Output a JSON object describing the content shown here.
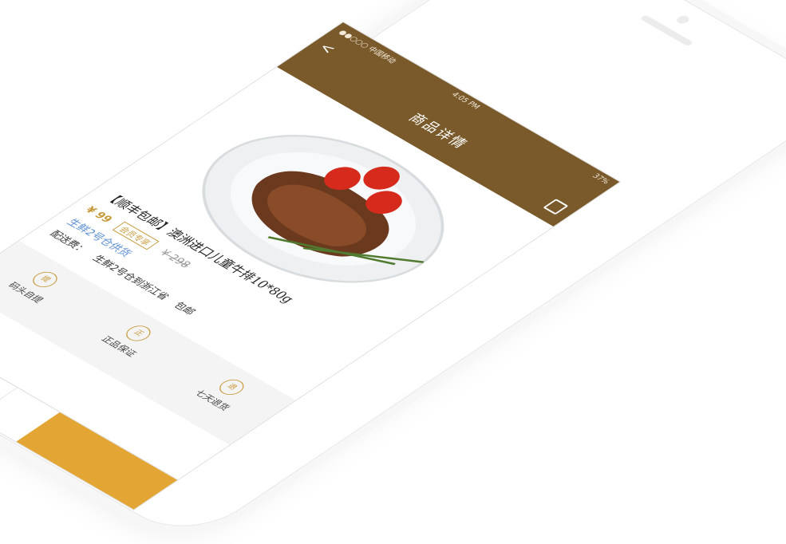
{
  "status": {
    "carrier": "●●○○○ 中国移动",
    "time": "4:05 PM",
    "battery": "37%"
  },
  "header": {
    "title": "商品详情",
    "back_icon": "chevron-left-icon",
    "share_icon": "share-icon"
  },
  "product": {
    "name": "【顺丰包邮】澳洲进口儿童牛排10*80g",
    "price": "¥ 99",
    "tag": "会员专享",
    "old_price": "¥ 298",
    "warehouse": "生鲜2号仓供货",
    "shipping_label": "配送费：",
    "shipping_route": "生鲜2号仓到浙江省",
    "shipping_fee": "包邮"
  },
  "guarantees": [
    {
      "badge": "提",
      "label": "码头自提"
    },
    {
      "badge": "正",
      "label": "正品保证"
    },
    {
      "badge": "退",
      "label": "七天退货"
    }
  ],
  "bottom_bar": {
    "home_icon": "home-icon",
    "chat_icon": "chat-icon",
    "star_icon": "star-icon"
  },
  "colors": {
    "header_bg": "#7a5a2b",
    "accent": "#e3a534",
    "price": "#c79a3b",
    "warehouse": "#5b8fd6"
  }
}
